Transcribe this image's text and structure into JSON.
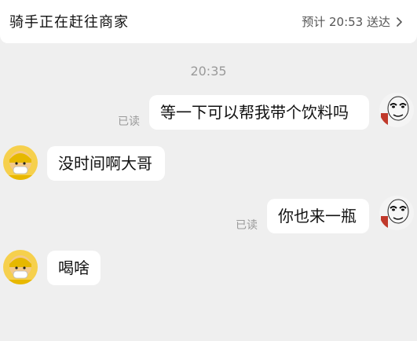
{
  "header": {
    "title": "骑手正在赶往商家",
    "eta_label": "预计 20:53 送达"
  },
  "chat": {
    "timestamp": "20:35",
    "read_label": "已读",
    "messages": [
      {
        "from": "me",
        "text": "等一下可以帮我带个饮料吗"
      },
      {
        "from": "rider",
        "text": "没时间啊大哥"
      },
      {
        "from": "me",
        "text": "你也来一瓶"
      },
      {
        "from": "rider",
        "text": "喝啥"
      }
    ]
  },
  "colors": {
    "background": "#efefef",
    "bubble": "#ffffff",
    "muted_text": "#9a9a9a"
  }
}
